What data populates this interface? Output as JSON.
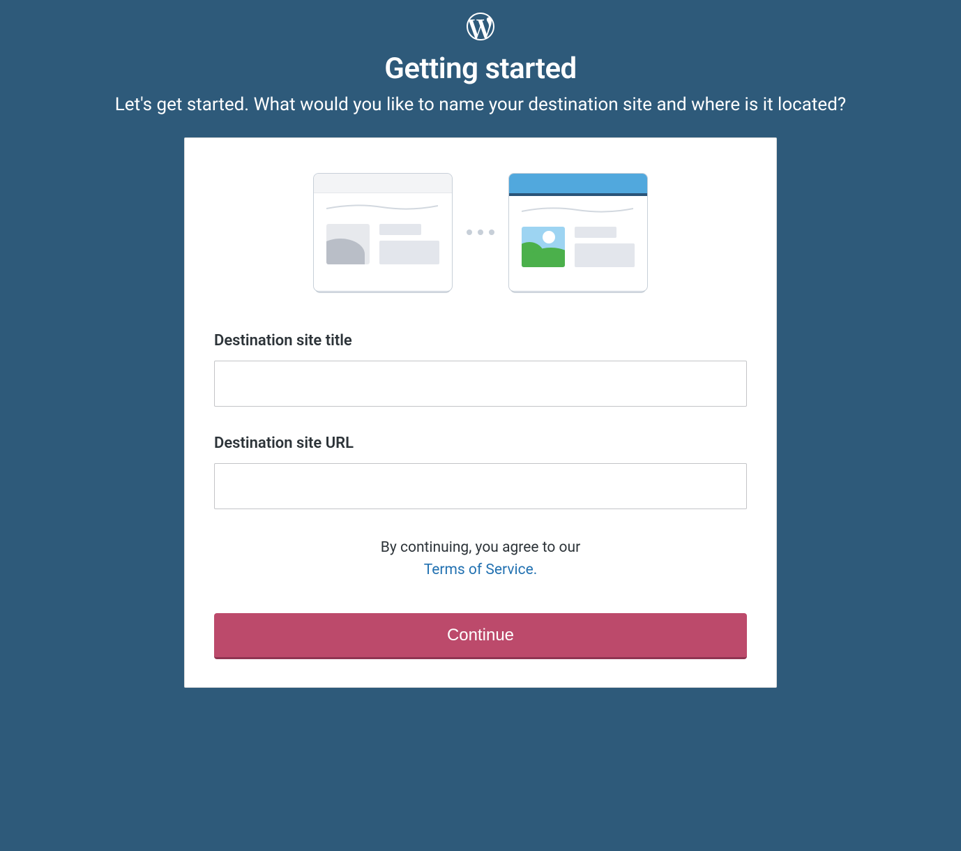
{
  "header": {
    "title": "Getting started",
    "subtitle": "Let's get started. What would you like to name your destination site and where is it located?"
  },
  "form": {
    "site_title_label": "Destination site title",
    "site_title_value": "",
    "site_url_label": "Destination site URL",
    "site_url_value": ""
  },
  "terms": {
    "preamble": "By continuing, you agree to our",
    "link_text": "Terms of Service."
  },
  "actions": {
    "continue_label": "Continue"
  },
  "icons": {
    "logo": "wordpress-logo"
  }
}
